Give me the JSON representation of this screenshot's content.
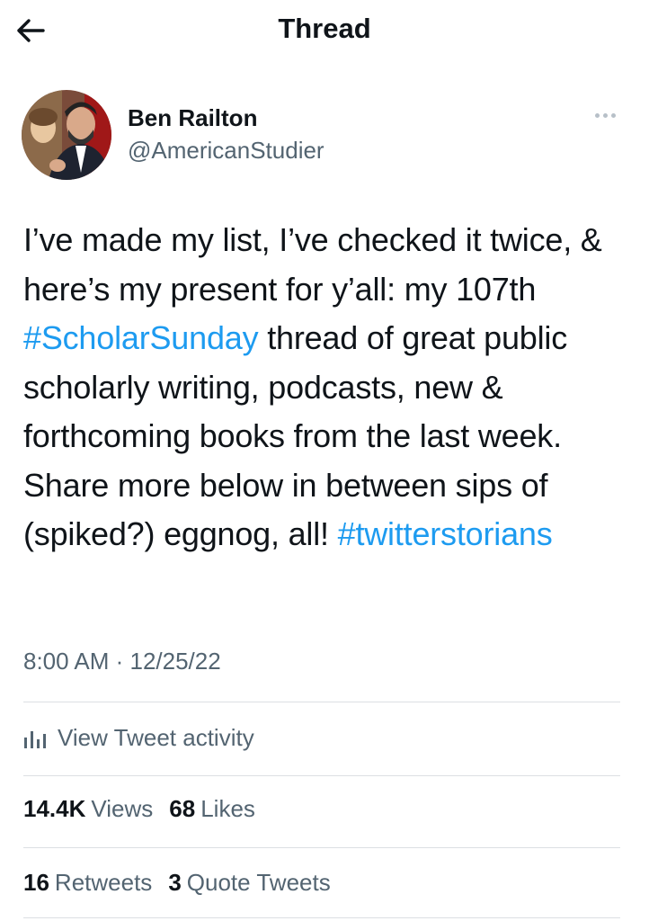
{
  "header": {
    "title": "Thread",
    "back_icon": "arrow-left-icon"
  },
  "author": {
    "name": "Ben Railton",
    "handle": "@AmericanStudier",
    "more_icon": "more-horizontal-icon"
  },
  "tweet": {
    "p1": "I’ve made my list, I’ve checked it twice, & here’s my present for y’all: my 107th ",
    "hashtag1": "#ScholarSunday",
    "p2": " thread of great public scholarly writing, podcasts, new & forthcoming books from the last week. Share more below in between sips of (spiked?) eggnog, all! ",
    "hashtag2": "#twitterstorians"
  },
  "meta": {
    "timestamp": "8:00 AM · 12/25/22"
  },
  "activity": {
    "label": "View Tweet activity",
    "icon": "bar-chart-icon"
  },
  "stats": {
    "views_count": "14.4K",
    "views_label": "Views",
    "likes_count": "68",
    "likes_label": "Likes",
    "retweets_count": "16",
    "retweets_label": "Retweets",
    "quotes_count": "3",
    "quotes_label": "Quote Tweets"
  },
  "colors": {
    "link": "#1d9bf0",
    "secondary": "#536471",
    "text": "#0f1419",
    "divider": "#dcdfe3"
  }
}
